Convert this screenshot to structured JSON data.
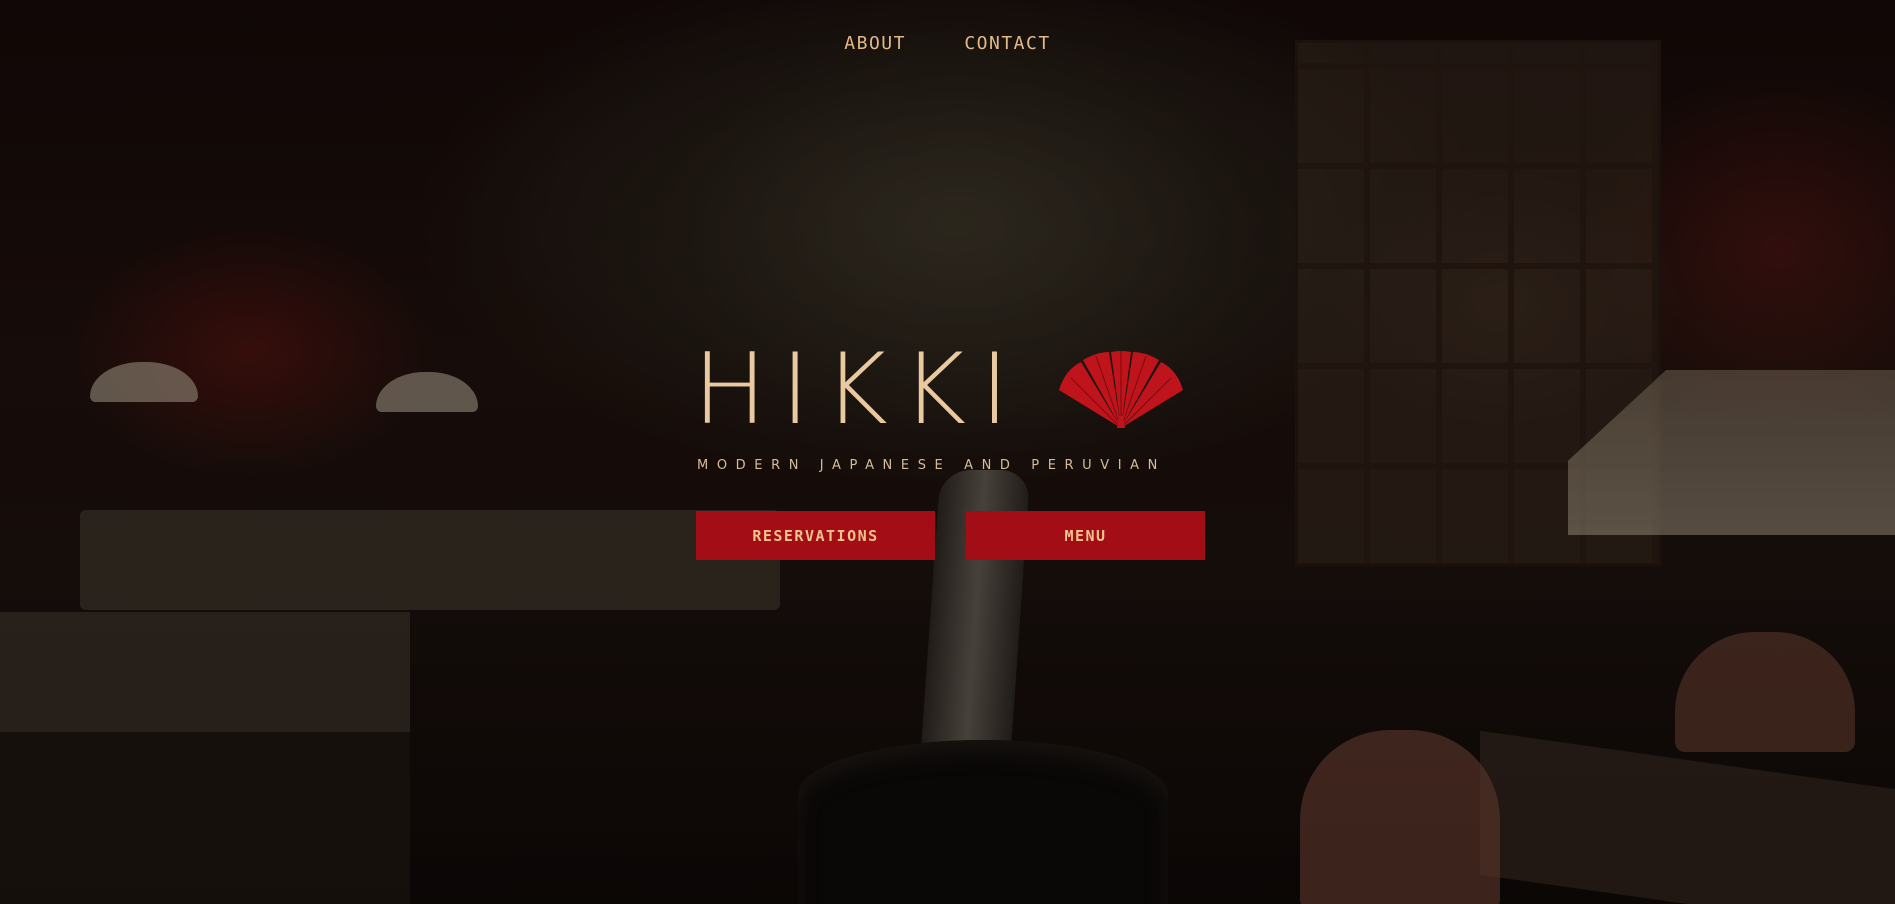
{
  "nav": {
    "items": [
      {
        "label": "ABOUT"
      },
      {
        "label": "CONTACT"
      }
    ]
  },
  "brand": {
    "name": "HIKKI",
    "logo_icon": "ginkgo-fan-icon",
    "tagline": "MODERN JAPANESE AND PERUVIAN"
  },
  "actions": {
    "reservations_label": "RESERVATIONS",
    "menu_label": "MENU"
  },
  "colors": {
    "accent_gold": "#e2b987",
    "button_red": "#a30d15",
    "fan_red": "#c0141c"
  }
}
